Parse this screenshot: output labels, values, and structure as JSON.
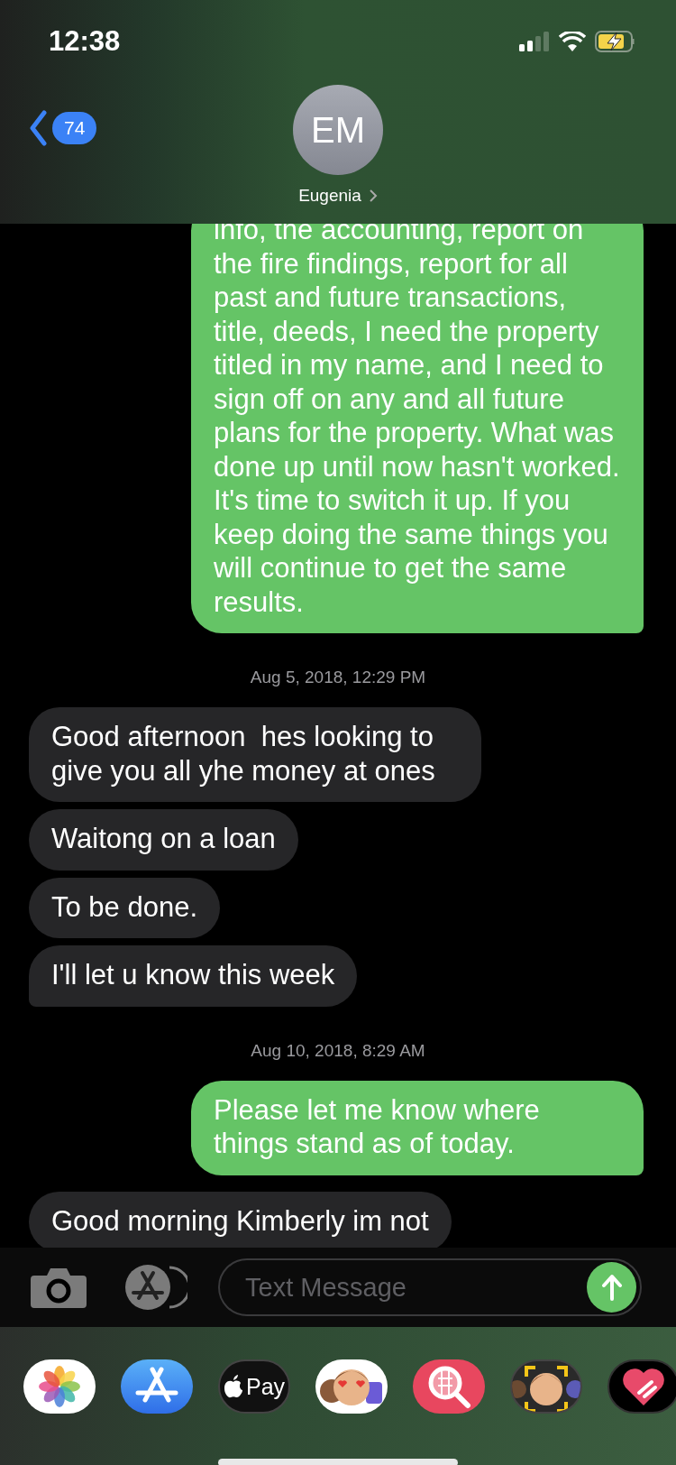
{
  "status_bar": {
    "time": "12:38"
  },
  "header": {
    "back_badge": "74",
    "avatar_initials": "EM",
    "contact_name": "Eugenia"
  },
  "messages": [
    {
      "kind": "sent",
      "tail": true,
      "text": "info, the accounting, report on the fire findings, report for all past and future transactions, title, deeds, I need the property titled in my name, and I need to sign off on any and all future plans for the property. What was done up until now hasn't worked. It's time to switch it up. If you keep doing the same things you will continue to get the same results."
    },
    {
      "kind": "timestamp",
      "text": "Aug 5, 2018, 12:29 PM"
    },
    {
      "kind": "received",
      "tail": false,
      "text": "Good afternoon  hes looking to give you all yhe money at ones"
    },
    {
      "kind": "received",
      "tail": false,
      "text": "Waitong on a loan"
    },
    {
      "kind": "received",
      "tail": false,
      "text": "To be done."
    },
    {
      "kind": "received",
      "tail": true,
      "text": "I'll let u know this week"
    },
    {
      "kind": "timestamp",
      "text": "Aug 10, 2018, 8:29 AM"
    },
    {
      "kind": "sent",
      "tail": true,
      "text": "Please let me know where things stand as of today."
    },
    {
      "kind": "received",
      "tail": false,
      "text": "Good morning Kimberly im not"
    }
  ],
  "compose": {
    "placeholder": "Text Message"
  },
  "app_drawer": [
    {
      "kind": "photos"
    },
    {
      "kind": "appstore"
    },
    {
      "kind": "pay",
      "label": "Pay"
    },
    {
      "kind": "stickers"
    },
    {
      "kind": "imagesearch"
    },
    {
      "kind": "avatar"
    },
    {
      "kind": "heart"
    }
  ]
}
